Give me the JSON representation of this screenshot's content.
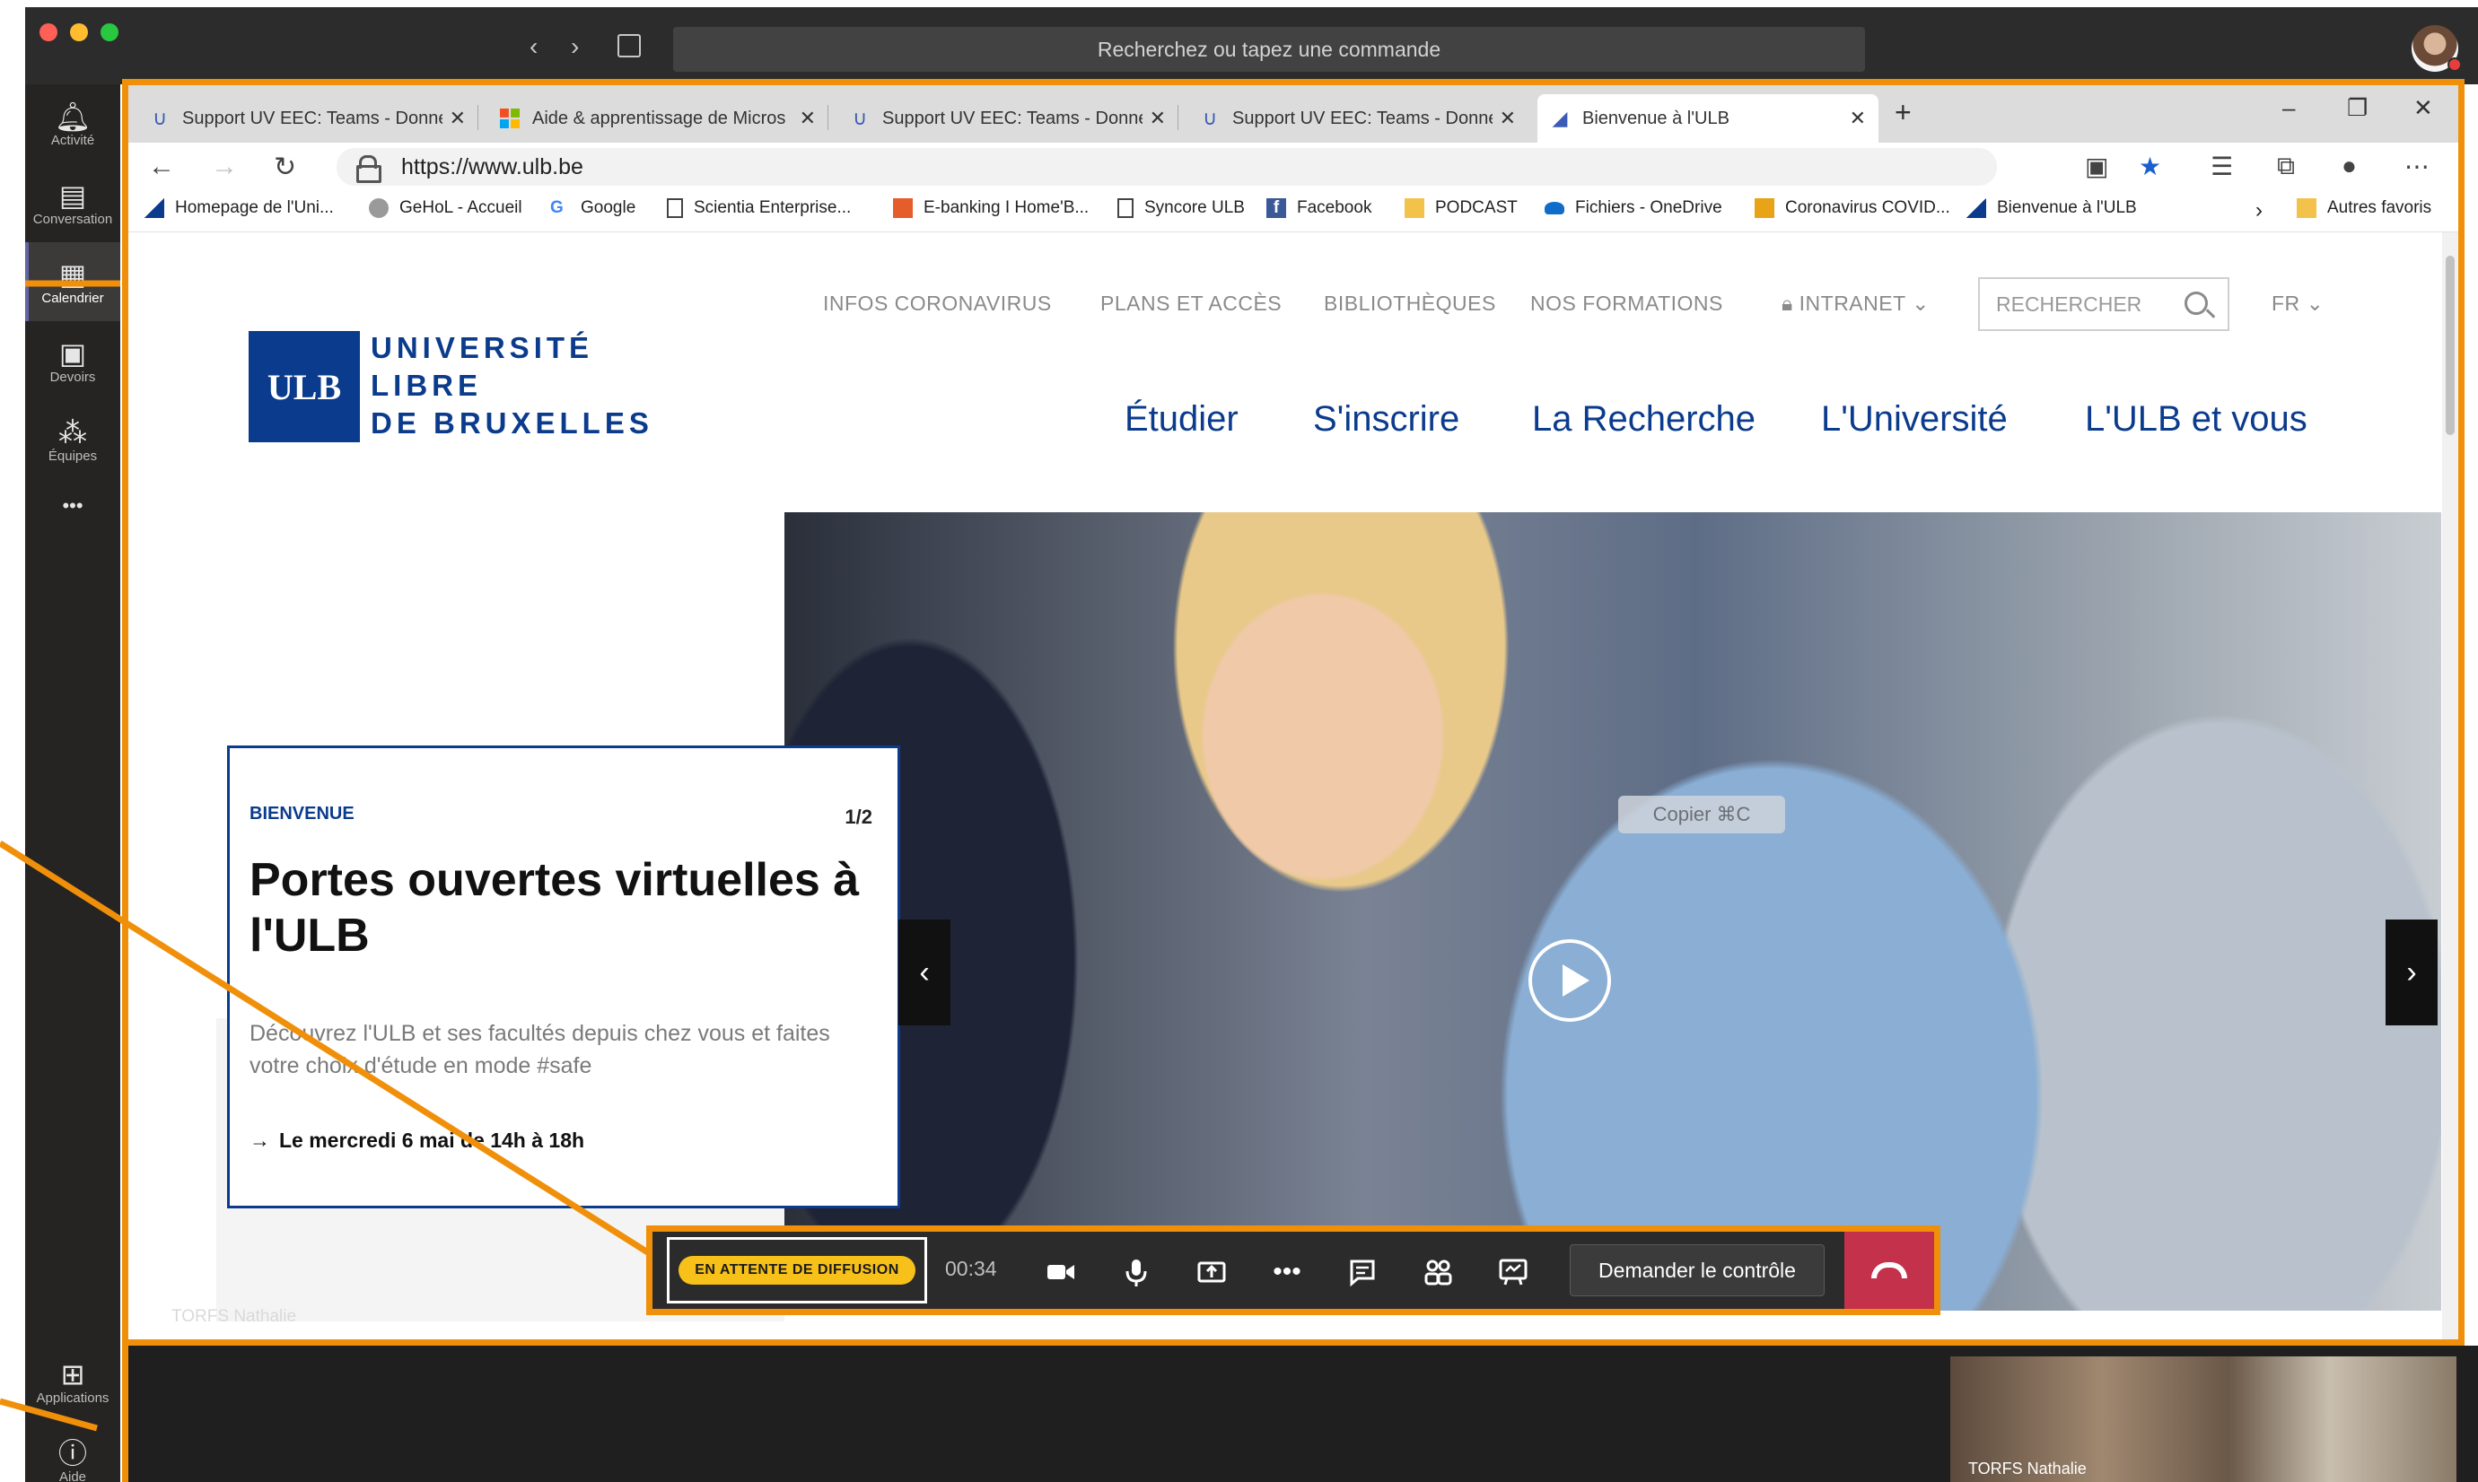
{
  "teams": {
    "search_placeholder": "Recherchez ou tapez une commande",
    "rail": [
      {
        "label": "Activité",
        "icon": "bell-icon"
      },
      {
        "label": "Conversation",
        "icon": "chat-icon"
      },
      {
        "label": "Calendrier",
        "icon": "calendar-icon"
      },
      {
        "label": "Devoirs",
        "icon": "backpack-icon"
      },
      {
        "label": "Équipes",
        "icon": "teams-icon"
      },
      {
        "label": "Applications",
        "icon": "apps-icon"
      },
      {
        "label": "Aide",
        "icon": "help-icon"
      }
    ],
    "more_label": "•••",
    "participant_name": "TORFS Nathalie"
  },
  "browser": {
    "tabs": [
      {
        "label": "Support UV EEC: Teams - Donne",
        "icon": "ulb-u-icon"
      },
      {
        "label": "Aide & apprentissage de Micros",
        "icon": "microsoft-logo-icon"
      },
      {
        "label": "Support UV EEC: Teams - Donne",
        "icon": "ulb-u-icon"
      },
      {
        "label": "Support UV EEC: Teams - Donne",
        "icon": "ulb-u-icon"
      },
      {
        "label": "Bienvenue à l'ULB",
        "icon": "ulb-flag-icon"
      }
    ],
    "url": "https://www.ulb.be",
    "favorites": [
      "Homepage de l'Uni...",
      "GeHoL - Accueil",
      "Google",
      "Scientia Enterprise...",
      "E-banking I Home'B...",
      "Syncore ULB",
      "Facebook",
      "PODCAST",
      "Fichiers - OneDrive",
      "Coronavirus COVID...",
      "Bienvenue à l'ULB"
    ],
    "other_favorites": "Autres favoris"
  },
  "site": {
    "utility_nav": [
      "INFOS CORONAVIRUS",
      "PLANS ET ACCÈS",
      "BIBLIOTHÈQUES",
      "NOS FORMATIONS",
      "INTRANET"
    ],
    "search_placeholder": "RECHERCHER",
    "language": "FR",
    "logo_mark": "ULB",
    "logo_lines": [
      "UNIVERSITÉ",
      "LIBRE",
      "DE BRUXELLES"
    ],
    "main_nav": [
      "Étudier",
      "S'inscrire",
      "La Recherche",
      "L'Université",
      "L'ULB et vous"
    ],
    "card": {
      "kicker": "BIENVENUE",
      "counter": "1/2",
      "title": "Portes ouvertes virtuelles à l'ULB",
      "description": "Découvrez l'ULB et ses facultés depuis chez vous et faites votre choix d'étude en mode #safe",
      "date": "Le mercredi 6 mai de 14h à 18h"
    },
    "copy_tooltip": "Copier   ⌘C",
    "presenter_tag": "TORFS Nathalie"
  },
  "call": {
    "broadcast_status": "EN ATTENTE DE DIFFUSION",
    "timer": "00:34",
    "request_control": "Demander le contrôle"
  },
  "colors": {
    "annotation": "#f0900a",
    "ulb_blue": "#0b3b8c",
    "hangup": "#c4314b",
    "teams_purple": "#6264a7",
    "broadcast_badge": "#f7c11a"
  }
}
